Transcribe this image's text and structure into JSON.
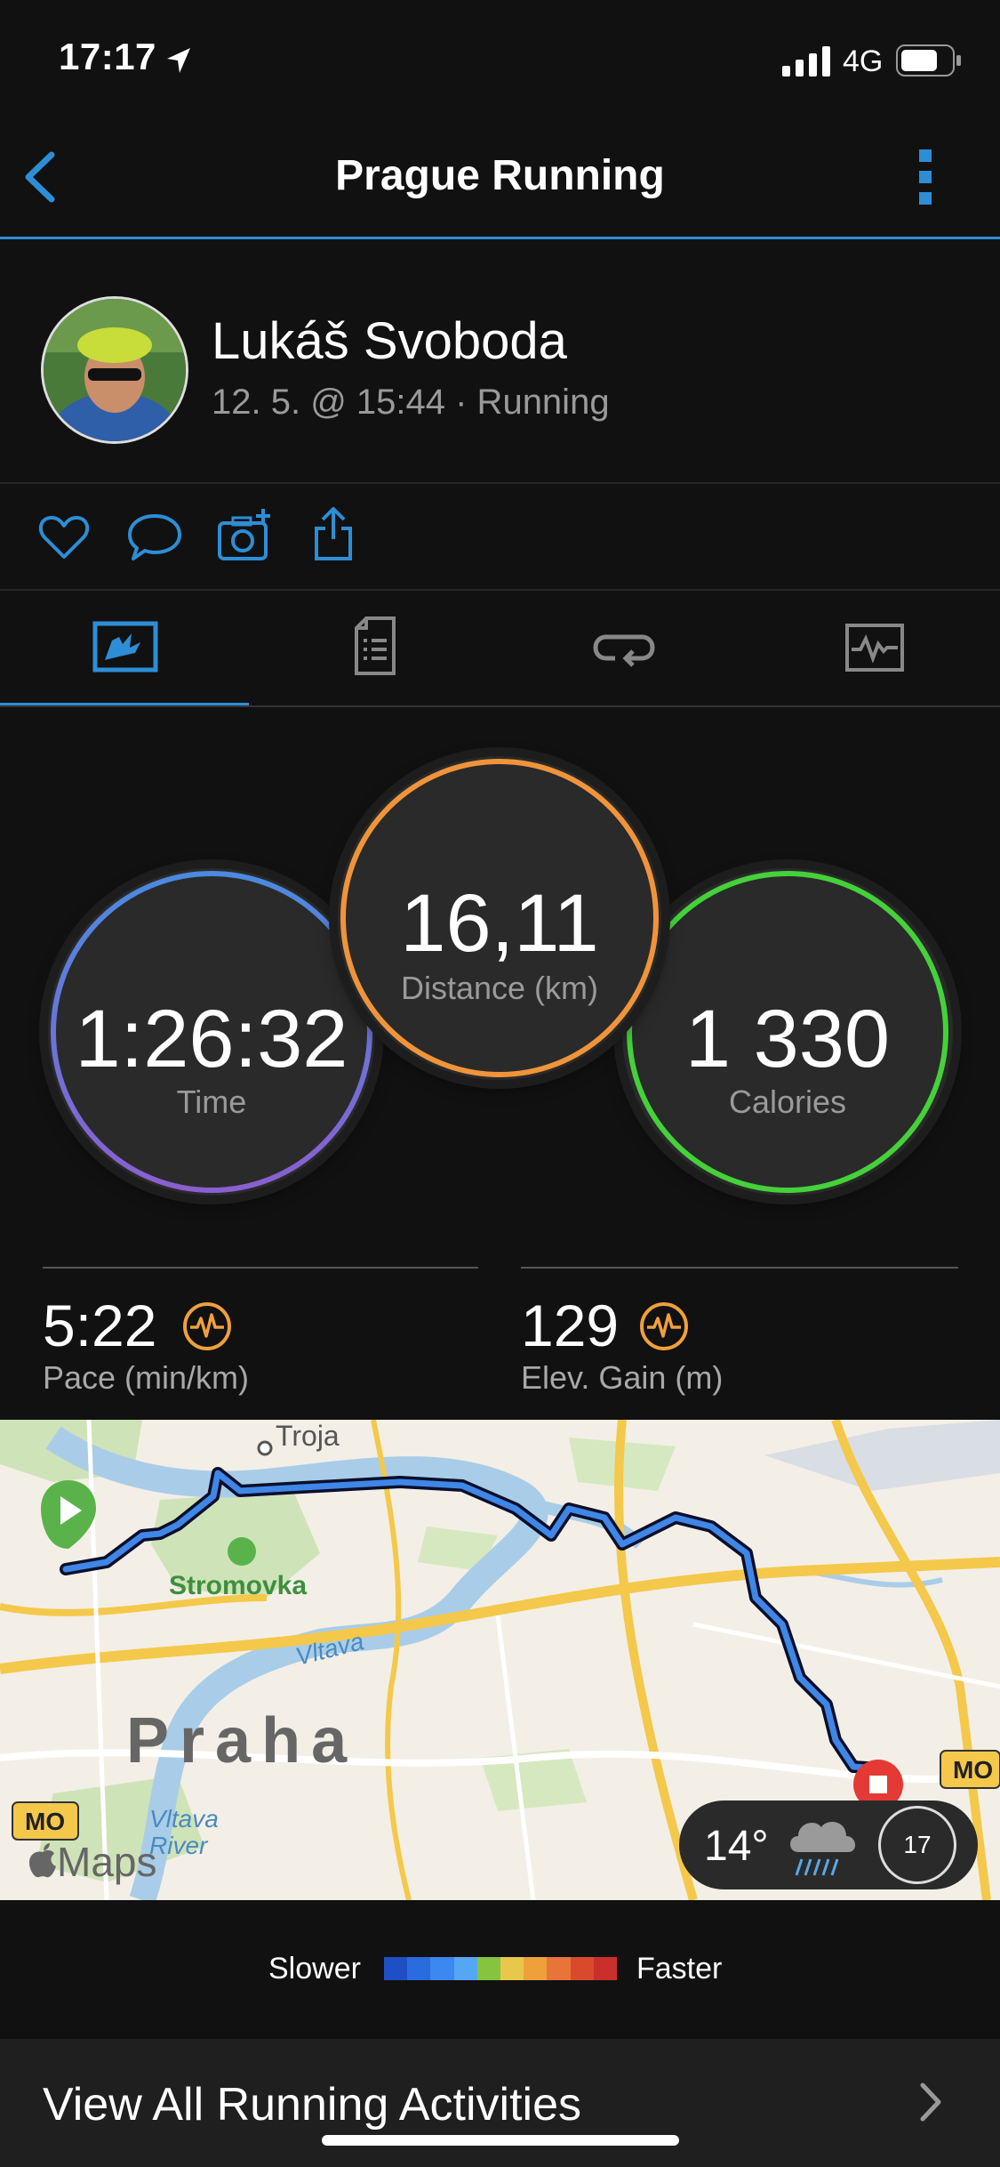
{
  "status_bar": {
    "time": "17:17",
    "network": "4G"
  },
  "header": {
    "title": "Prague Running"
  },
  "profile": {
    "name": "Lukáš Svoboda",
    "meta": "12. 5. @ 15:44 · Running"
  },
  "stats": {
    "time": {
      "value": "1:26:32",
      "label": "Time"
    },
    "distance": {
      "value": "16,11",
      "label": "Distance (km)"
    },
    "calories": {
      "value": "1 330",
      "label": "Calories"
    },
    "pace": {
      "value": "5:22",
      "label": "Pace (min/km)"
    },
    "elevation": {
      "value": "129",
      "label": "Elev. Gain (m)"
    }
  },
  "map": {
    "labels": {
      "troja": "Troja",
      "stromovka": "Stromovka",
      "vltava": "Vltava",
      "praha": "Praha",
      "vltava_river": "Vltava\nRiver",
      "mo_left": "MO",
      "mo_right": "MO",
      "maps": "Maps"
    },
    "weather": {
      "temp": "14°",
      "hour": "17"
    }
  },
  "legend": {
    "slower": "Slower",
    "faster": "Faster",
    "colors": [
      "#1f4fc4",
      "#2b6be0",
      "#3a88f0",
      "#55a7f5",
      "#86c440",
      "#e8c84a",
      "#f0a03a",
      "#e8743a",
      "#d94a2c",
      "#c9302a"
    ]
  },
  "footer": {
    "link": "View All Running Activities"
  },
  "colors": {
    "accent": "#2d8ed6",
    "orange": "#f0a03a"
  }
}
